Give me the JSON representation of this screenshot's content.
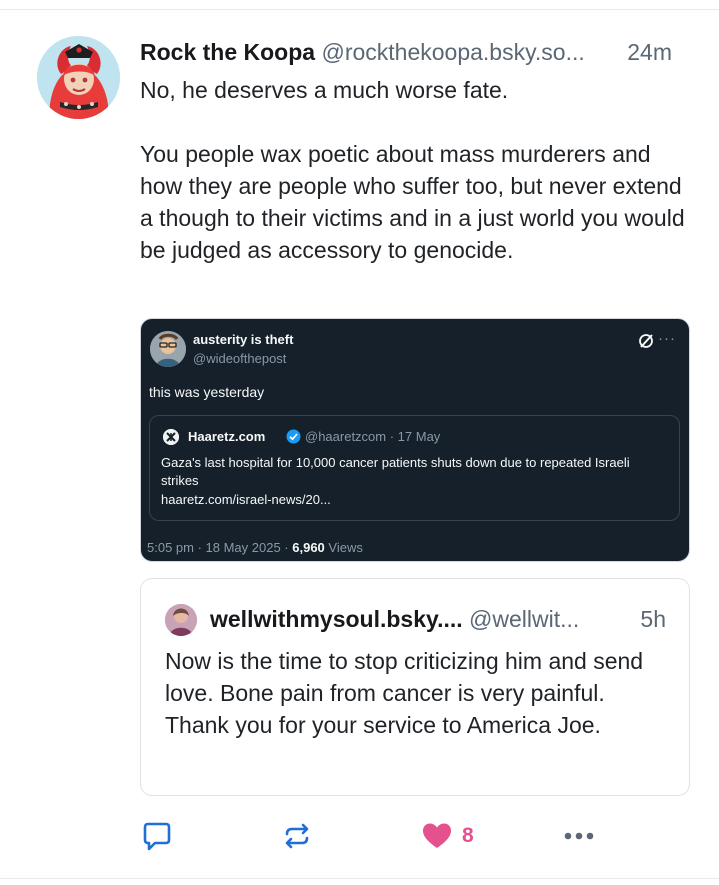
{
  "post": {
    "author_name": "Rock the Koopa",
    "author_handle": "@rockthekoopa.bsky.so...",
    "time": "24m",
    "paragraphs": [
      "No, he deserves a much worse fate.",
      "You people wax poetic about mass murderers and how they are people who suffer too, but never extend a though to their victims and in a just world you would be judged as accessory to genocide."
    ]
  },
  "embedded_screenshot": {
    "author_name": "austerity is theft",
    "author_handle": "@wideofthepost",
    "text": "this was yesterday",
    "quoted": {
      "source_name": "Haaretz.com",
      "meta": "@haaretzcom · 17 May",
      "text": "Gaza's last hospital for 10,000 cancer patients shuts down due to repeated Israeli strikes",
      "link": "haaretz.com/israel-news/20..."
    },
    "footer_time": "5:05 pm · 18 May 2025 · ",
    "views_count": "6,960",
    "views_label": " Views"
  },
  "quoted_post": {
    "author_name": "wellwithmysoul.bsky....",
    "author_handle": "@wellwit...",
    "time": "5h",
    "text": "Now is the time to stop criticizing him and send love. Bone pain from cancer is very painful. Thank you for your service to America Joe."
  },
  "actions": {
    "like_count": "8",
    "like_color": "#e5508f",
    "icon_color": "#1f6fd6"
  }
}
